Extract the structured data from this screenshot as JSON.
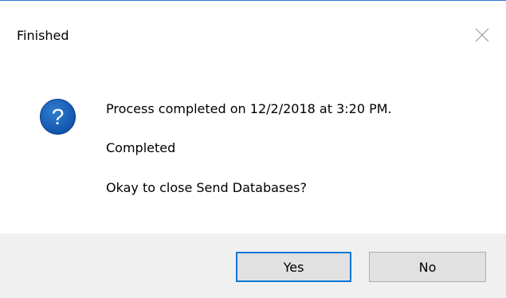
{
  "dialog": {
    "title": "Finished",
    "icon": "question-icon",
    "messages": [
      "Process completed on 12/2/2018 at 3:20 PM.",
      "Completed",
      "Okay to close Send Databases?"
    ],
    "buttons": {
      "yes_label": "Yes",
      "no_label": "No"
    }
  },
  "colors": {
    "accent": "#0078d7",
    "icon_fill": "#1565c0",
    "footer_bg": "#f0f0f0",
    "button_bg": "#e1e1e1"
  }
}
